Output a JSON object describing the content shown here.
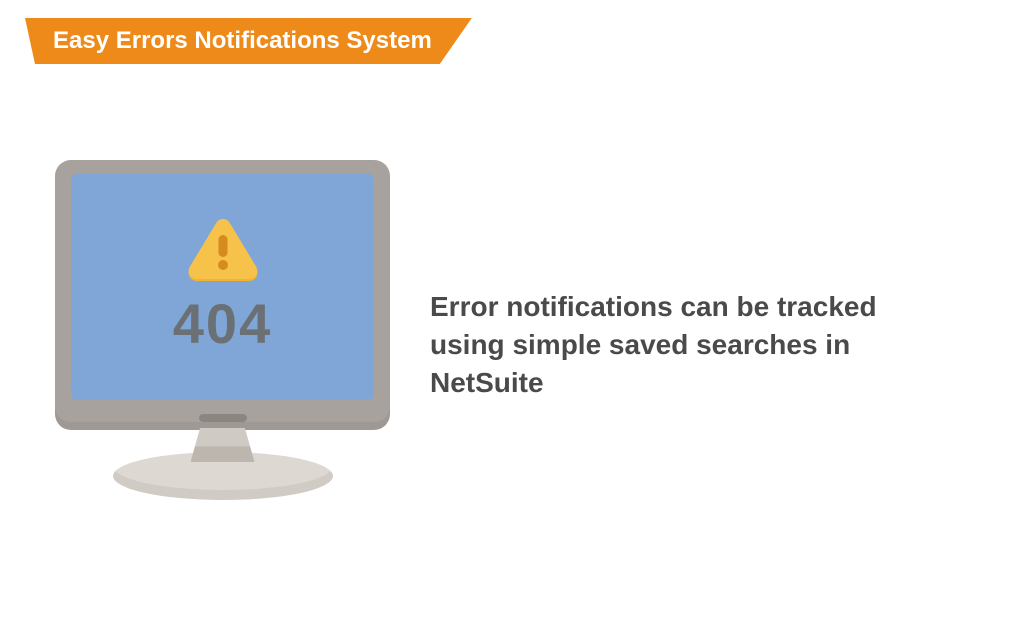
{
  "banner": {
    "title": "Easy Errors Notifications System"
  },
  "illustration": {
    "warning_icon": "warning-triangle",
    "error_code": "404"
  },
  "body_text": "Error notifications can be tracked using simple saved searches in NetSuite"
}
